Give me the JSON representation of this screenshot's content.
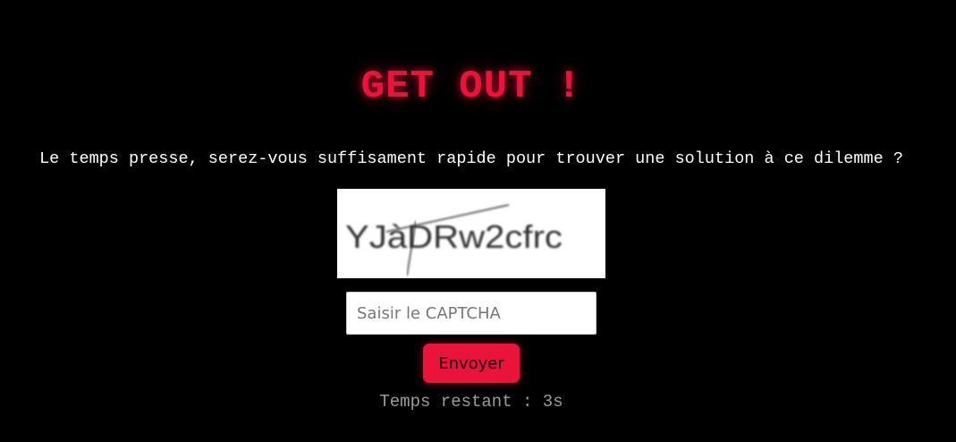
{
  "page": {
    "title": "GET OUT !",
    "subtitle": "Le temps presse, serez-vous suffisament rapide pour trouver une solution à ce dilemme ?"
  },
  "captcha": {
    "image_text": "YJàDRw2cfrc",
    "input_placeholder": "Saisir le CAPTCHA",
    "input_value": ""
  },
  "form": {
    "submit_label": "Envoyer"
  },
  "timer": {
    "text": "Temps restant : 3s"
  },
  "colors": {
    "background": "#000000",
    "accent": "#e8143c",
    "text": "#ffffff",
    "muted_text": "#9a9a9a"
  }
}
